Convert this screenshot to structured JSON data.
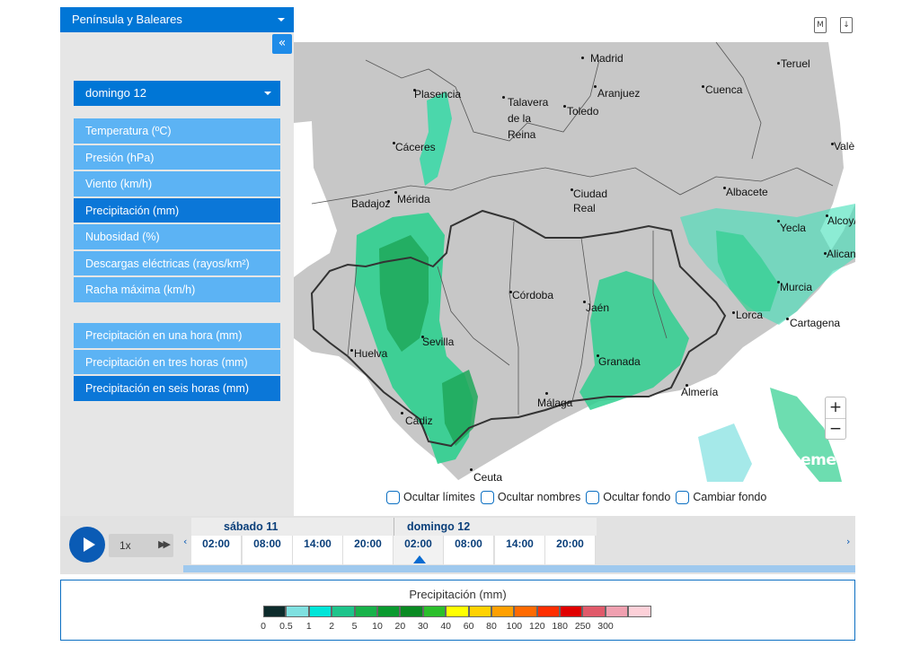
{
  "region_selector": {
    "label": "Península y Baleares"
  },
  "collapse_label": "«",
  "day_selector": {
    "label": "domingo 12"
  },
  "menu_primary": [
    {
      "label": "Temperatura (ºC)",
      "active": false
    },
    {
      "label": "Presión (hPa)",
      "active": false
    },
    {
      "label": "Viento (km/h)",
      "active": false
    },
    {
      "label": "Precipitación (mm)",
      "active": true
    },
    {
      "label": "Nubosidad (%)",
      "active": false
    },
    {
      "label": "Descargas eléctricas (rayos/km²)",
      "active": false
    },
    {
      "label": "Racha máxima (km/h)",
      "active": false
    }
  ],
  "menu_secondary": [
    {
      "label": "Precipitación en una hora (mm)",
      "active": false
    },
    {
      "label": "Precipitación en tres horas (mm)",
      "active": false
    },
    {
      "label": "Precipitación en seis horas (mm)",
      "active": true
    }
  ],
  "top_icons": {
    "metadata_icon_label": "M",
    "download_icon_label": "↓"
  },
  "map": {
    "cities": [
      "Madrid",
      "Teruel",
      "Plasencia",
      "Talavera de la Reina",
      "Aranjuez",
      "Cuenca",
      "Toledo",
      "Cáceres",
      "Valè",
      "Badajoz",
      "Mérida",
      "Ciudad Real",
      "Albacete",
      "Alcoy/",
      "Yecla",
      "Alican",
      "Córdoba",
      "Jaén",
      "Murcia",
      "Lorca",
      "Cartagena",
      "Huelva",
      "Sevilla",
      "Granada",
      "Almería",
      "Málaga",
      "Cádiz",
      "Ceuta"
    ],
    "zoom_in": "+",
    "zoom_out": "−",
    "brand": "aemet"
  },
  "options": [
    {
      "label": "Ocultar límites",
      "checked": false
    },
    {
      "label": "Ocultar nombres",
      "checked": false
    },
    {
      "label": "Ocultar fondo",
      "checked": false
    },
    {
      "label": "Cambiar fondo",
      "checked": false
    }
  ],
  "timeline": {
    "speed": "1x",
    "days": [
      {
        "label": "sábado 11",
        "hours": [
          "02:00",
          "08:00",
          "14:00",
          "20:00"
        ]
      },
      {
        "label": "domingo 12",
        "hours": [
          "02:00",
          "08:00",
          "14:00",
          "20:00"
        ]
      }
    ],
    "selected_day": 1,
    "selected_hour": 0,
    "prev_arrow": "‹",
    "next_arrow": "›"
  },
  "legend": {
    "title": "Precipitación (mm)",
    "values": [
      "0",
      "0.5",
      "1",
      "2",
      "5",
      "10",
      "20",
      "30",
      "40",
      "60",
      "80",
      "100",
      "120",
      "180",
      "250",
      "300"
    ],
    "colors": [
      "#0d2b2b",
      "#7fe0e0",
      "#00e5d8",
      "#1ec48b",
      "#18b24a",
      "#0a9a2f",
      "#0a8a22",
      "#2bbf2b",
      "#ffff00",
      "#ffd200",
      "#ffa000",
      "#ff6a00",
      "#ff2e00",
      "#e00000",
      "#e05a6a",
      "#f0a0b0",
      "#fcd0d8"
    ]
  },
  "colors": {
    "accent": "#0076d6",
    "menu_item": "#5cb3f4",
    "menu_active": "#0b77d8",
    "map_land": "#c7c7c7",
    "map_sea": "#ffffff"
  }
}
